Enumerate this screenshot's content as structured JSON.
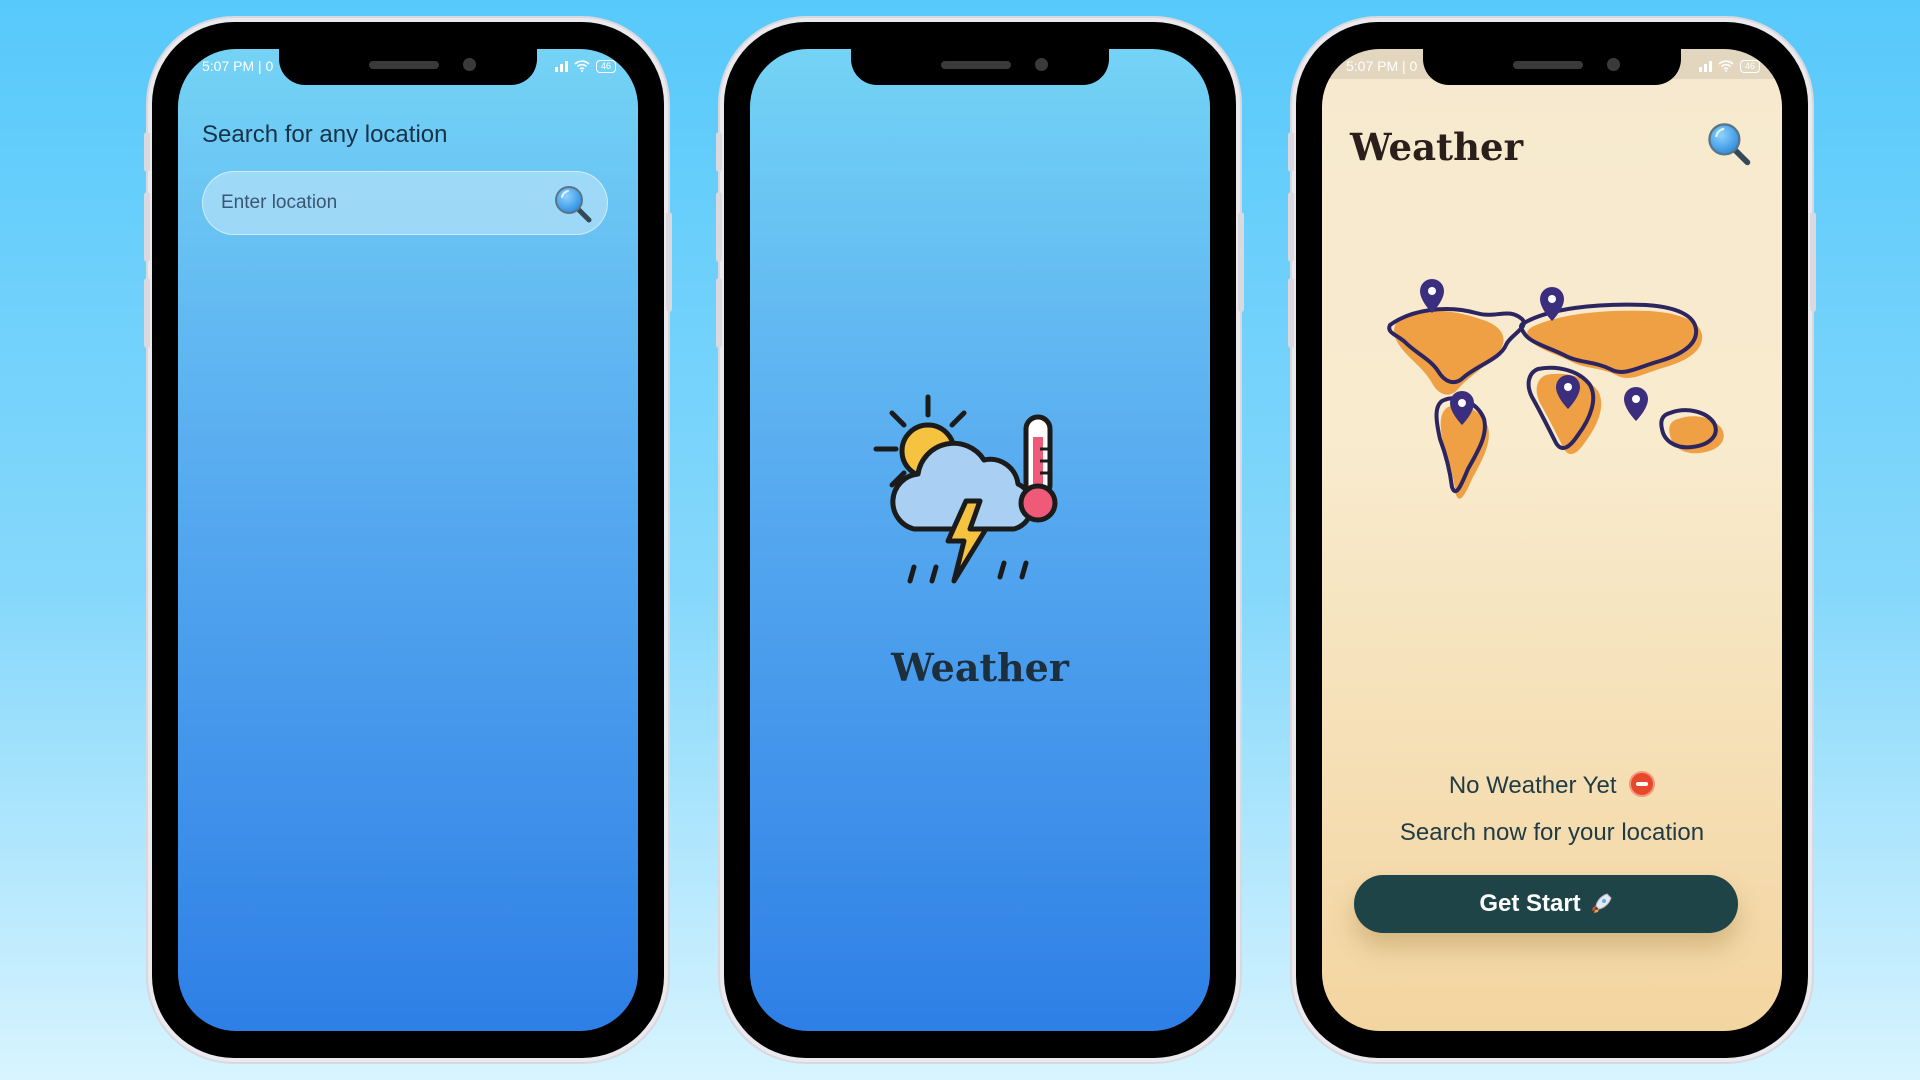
{
  "phones": {
    "left": {
      "status_time": "5:07 PM | 0",
      "battery": "46",
      "search_title": "Search for any location",
      "search_placeholder": "Enter location"
    },
    "center": {
      "app_name": "Weather"
    },
    "right": {
      "status_time": "5:07 PM | 0",
      "battery": "46",
      "app_title": "Weather",
      "empty_title": "No Weather Yet",
      "empty_subtitle": "Search now for your location",
      "cta_label": "Get Start"
    }
  },
  "icons": [
    "search-icon",
    "weather-storm-icon",
    "thermometer-icon",
    "world-map-icon",
    "location-pin-icon",
    "no-entry-icon",
    "rocket-icon",
    "wifi-icon",
    "signal-icon",
    "battery-icon"
  ],
  "colors": {
    "background": "#57c9fb",
    "blue_screen_top": "#74d3f5",
    "blue_screen_bottom": "#2e7fe6",
    "cream_screen": "#f6e9cf",
    "button_dark": "#1e4447",
    "map_orange": "#f0a044",
    "pin_purple": "#3b2e7e"
  }
}
